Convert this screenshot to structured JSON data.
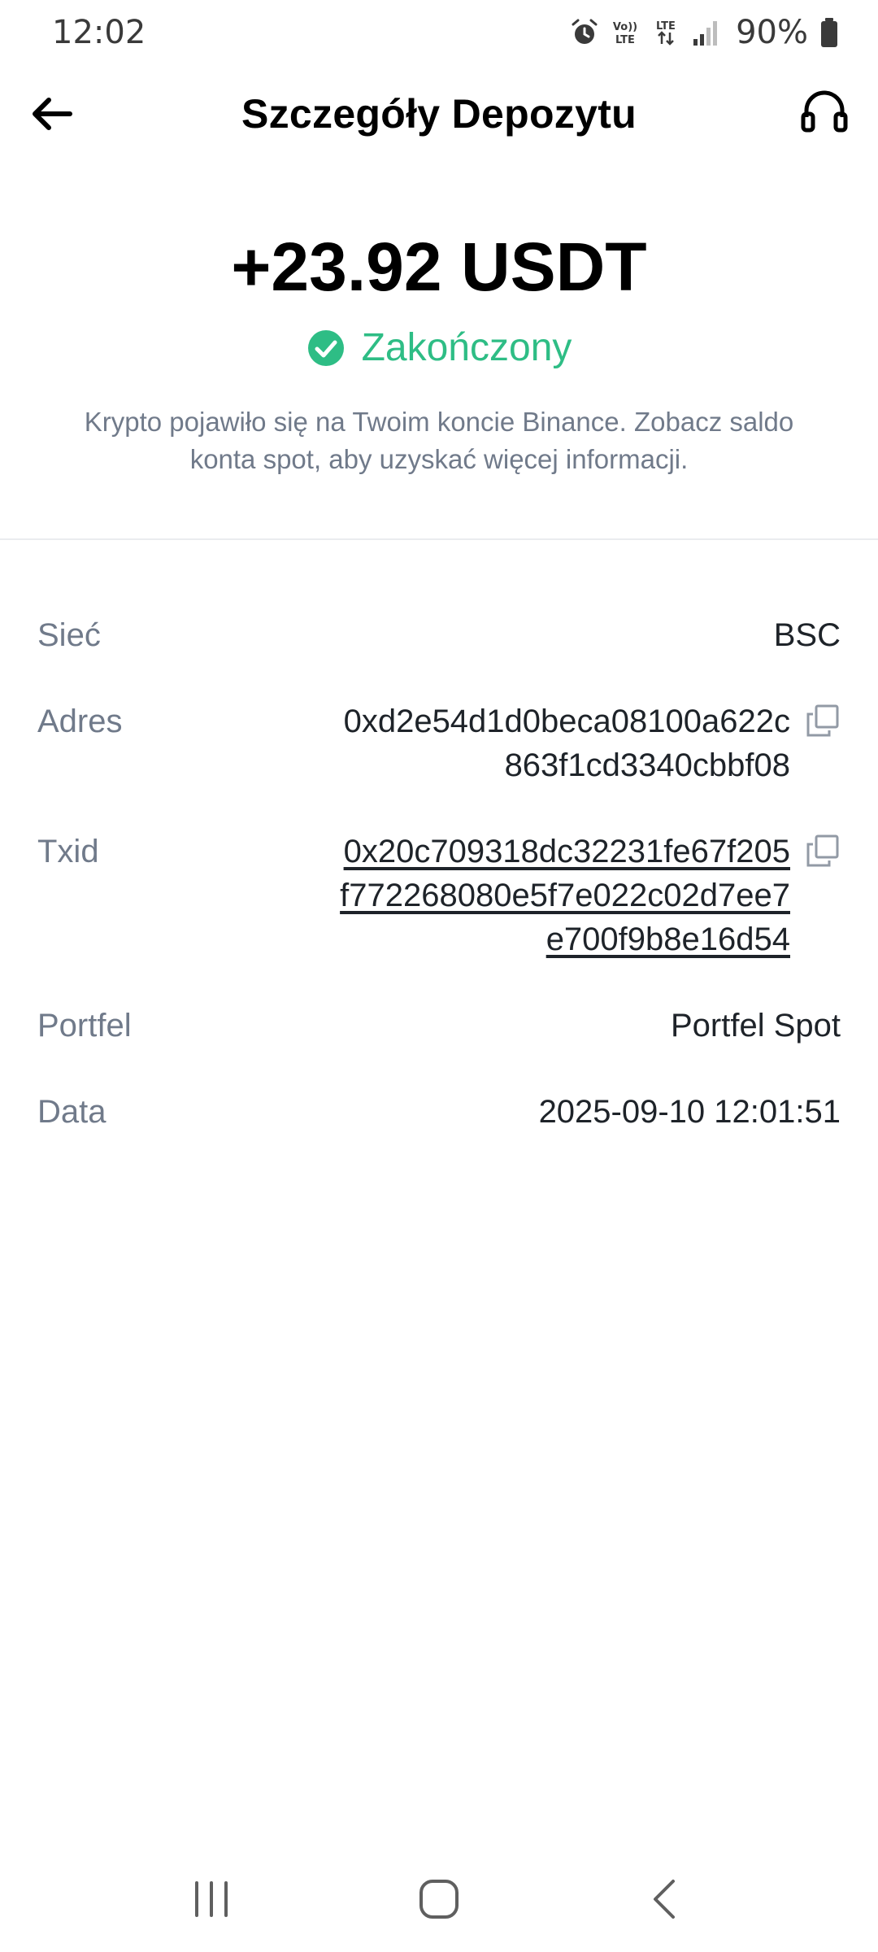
{
  "status_bar": {
    "time": "12:02",
    "battery_pct": "90%",
    "icons": [
      "alarm-icon",
      "volte-icon",
      "lte-icon",
      "signal-icon",
      "battery-icon"
    ],
    "volte_top": "Vo))",
    "volte_bottom": "LTE",
    "lte_label": "LTE"
  },
  "header": {
    "title": "Szczegóły Depozytu",
    "back_icon": "arrow-left-icon",
    "support_icon": "headset-icon"
  },
  "summary": {
    "amount": "+23.92 USDT",
    "status": "Zakończony",
    "status_color": "#2ebd85",
    "description": "Krypto pojawiło się na Twoim koncie Binance. Zobacz saldo konta spot, aby uzyskać więcej informacji."
  },
  "details": {
    "network": {
      "label": "Sieć",
      "value": "BSC"
    },
    "address": {
      "label": "Adres",
      "lines": [
        "0xd2e54d1d0beca08100a622c",
        "863f1cd3340cbbf08"
      ]
    },
    "txid": {
      "label": "Txid",
      "lines": [
        "0x20c709318dc32231fe67f205",
        "f772268080e5f7e022c02d7ee7",
        "e700f9b8e16d54"
      ]
    },
    "wallet": {
      "label": "Portfel",
      "value": "Portfel Spot"
    },
    "date": {
      "label": "Data",
      "value": "2025-09-10 12:01:51"
    }
  },
  "nav_bar": {
    "icons": [
      "recent-apps-icon",
      "home-icon",
      "back-icon"
    ]
  }
}
